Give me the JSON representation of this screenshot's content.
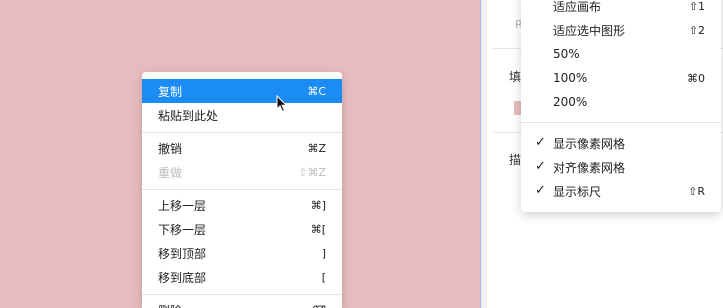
{
  "context_menu": {
    "items": [
      {
        "label": "复制",
        "shortcut": "⌘C"
      },
      {
        "label": "粘贴到此处",
        "shortcut": ""
      },
      {
        "label": "撤销",
        "shortcut": "⌘Z"
      },
      {
        "label": "重做",
        "shortcut": "⇧⌘Z"
      },
      {
        "label": "上移一层",
        "shortcut": "⌘]"
      },
      {
        "label": "下移一层",
        "shortcut": "⌘["
      },
      {
        "label": "移到顶部",
        "shortcut": "]"
      },
      {
        "label": "移到底部",
        "shortcut": "["
      },
      {
        "label": "删除",
        "shortcut": "⌫"
      }
    ]
  },
  "view_menu": {
    "items": [
      {
        "label": "适应画布",
        "shortcut": "⇧1"
      },
      {
        "label": "适应选中图形",
        "shortcut": "⇧2"
      },
      {
        "label": "50%",
        "shortcut": ""
      },
      {
        "label": "100%",
        "shortcut": "⌘0"
      },
      {
        "label": "200%",
        "shortcut": ""
      },
      {
        "label": "显示像素网格",
        "shortcut": "",
        "check": "✓"
      },
      {
        "label": "对齐像素网格",
        "shortcut": "",
        "check": "✓"
      },
      {
        "label": "显示标尺",
        "shortcut": "⇧R",
        "check": "✓"
      }
    ]
  },
  "panel": {
    "r_label": "R",
    "fill_label": "填充",
    "stroke_label": "描边"
  },
  "colors": {
    "canvas": "#e8bcbe",
    "accent": "#1c8cf5"
  }
}
